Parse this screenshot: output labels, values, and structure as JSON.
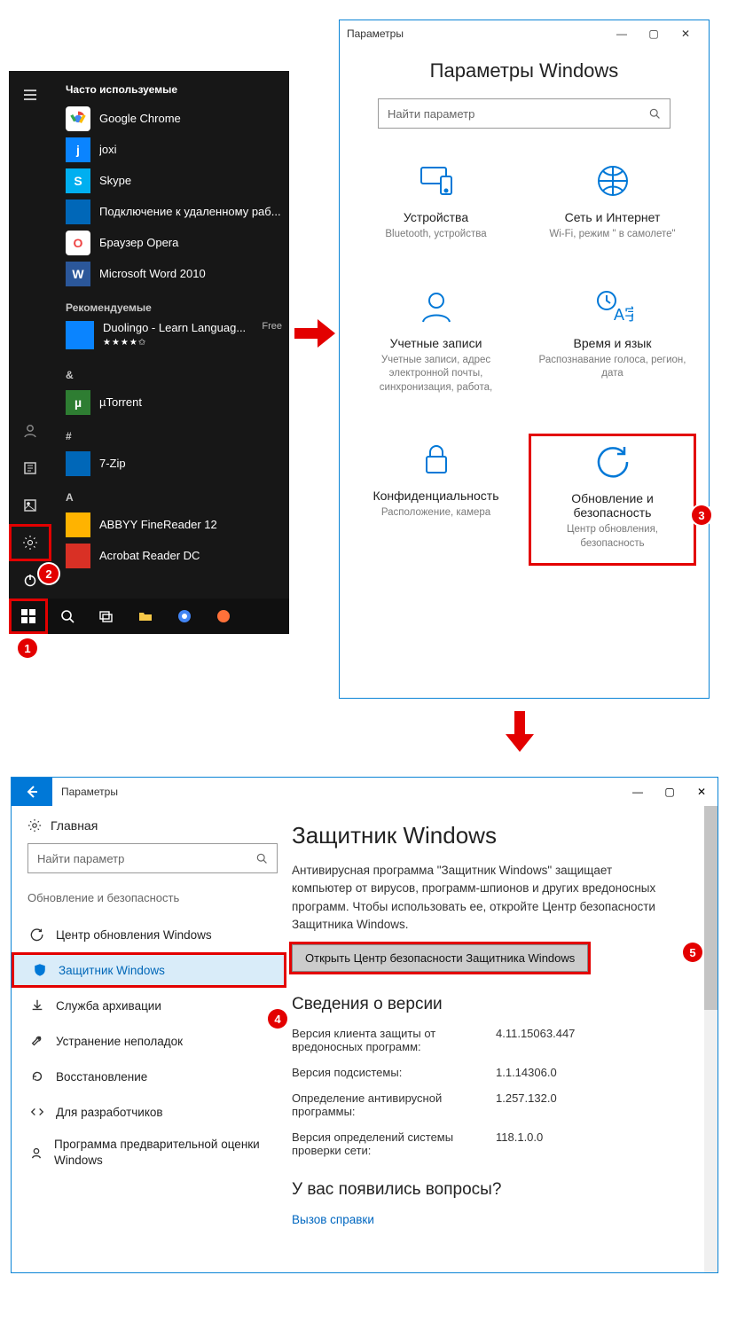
{
  "startmenu": {
    "headings": {
      "frequent": "Часто используемые",
      "recommended": "Рекомендуемые"
    },
    "letters": {
      "amp": "&",
      "hash": "#",
      "a": "A"
    },
    "apps": {
      "chrome": {
        "label": "Google Chrome",
        "bg": "#ffffff",
        "letter": ""
      },
      "joxi": {
        "label": "joxi",
        "bg": "#0a84ff",
        "letter": "j"
      },
      "skype": {
        "label": "Skype",
        "bg": "#00aff0",
        "letter": "S"
      },
      "rdp": {
        "label": "Подключение к удаленному раб...",
        "bg": "#0067b8",
        "letter": ""
      },
      "opera": {
        "label": "Браузер Opera",
        "bg": "#ffffff",
        "letter": "O"
      },
      "word": {
        "label": "Microsoft Word 2010",
        "bg": "#2b579a",
        "letter": "W"
      },
      "duolingo": {
        "label": "Duolingo - Learn Languag...",
        "bg": "#0a84ff",
        "letter": "",
        "extra": "Free",
        "stars": "★★★★✩"
      },
      "utorrent": {
        "label": "µTorrent",
        "bg": "#2e7d32",
        "letter": "µ"
      },
      "7zip": {
        "label": "7-Zip",
        "bg": "#0067b8",
        "letter": ""
      },
      "abbyy": {
        "label": "ABBYY FineReader 12",
        "bg": "#ffb300",
        "letter": ""
      },
      "acrobat": {
        "label": "Acrobat Reader DC",
        "bg": "#d93025",
        "letter": ""
      }
    }
  },
  "settings_top": {
    "window_title": "Параметры",
    "page_title": "Параметры Windows",
    "search_placeholder": "Найти параметр",
    "tiles": {
      "devices": {
        "title": "Устройства",
        "sub": "Bluetooth, устройства"
      },
      "network": {
        "title": "Сеть и Интернет",
        "sub": "Wi-Fi, режим \" в самолете\""
      },
      "accounts": {
        "title": "Учетные записи",
        "sub": "Учетные записи, адрес электронной почты, синхронизация, работа,"
      },
      "time": {
        "title": "Время и язык",
        "sub": "Распознавание голоса, регион, дата"
      },
      "privacy": {
        "title": "Конфиденциальность",
        "sub": "Расположение, камера"
      },
      "update": {
        "title": "Обновление и безопасность",
        "sub": "Центр обновления, безопасность"
      }
    }
  },
  "settings_detail": {
    "window_title": "Параметры",
    "home": "Главная",
    "search_placeholder": "Найти параметр",
    "category": "Обновление и безопасность",
    "side": {
      "update": "Центр обновления Windows",
      "defender": "Защитник Windows",
      "backup": "Служба архивации",
      "trouble": "Устранение неполадок",
      "recovery": "Восстановление",
      "dev": "Для разработчиков",
      "insider": "Программа предварительной оценки Windows"
    },
    "main": {
      "title": "Защитник Windows",
      "desc": "Антивирусная программа \"Защитник Windows\" защищает компьютер от вирусов, программ-шпионов и других вредоносных программ. Чтобы использовать ее, откройте Центр безопасности Защитника Windows.",
      "cta": "Открыть Центр безопасности Защитника Windows",
      "info_h": "Сведения о версии",
      "kv": {
        "k1": "Версия клиента защиты от вредоносных программ:",
        "v1": "4.11.15063.447",
        "k2": "Версия подсистемы:",
        "v2": "1.1.14306.0",
        "k3": "Определение антивирусной программы:",
        "v3": "1.257.132.0",
        "k4": "Версия определений системы проверки сети:",
        "v4": "118.1.0.0"
      },
      "faq_h": "У вас появились вопросы?",
      "faq_link": "Вызов справки"
    }
  },
  "badges": {
    "b1": "1",
    "b2": "2",
    "b3": "3",
    "b4": "4",
    "b5": "5"
  }
}
